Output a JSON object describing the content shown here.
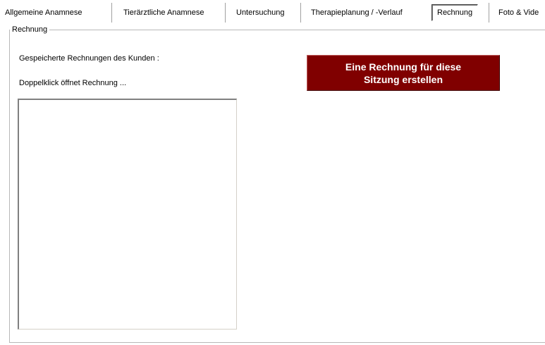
{
  "tabs": [
    {
      "label": "Allgemeine Anamnese",
      "active": false
    },
    {
      "label": "Tierärztliche Anamnese",
      "active": false
    },
    {
      "label": "Untersuchung",
      "active": false
    },
    {
      "label": "Therapieplanung / -Verlauf",
      "active": false
    },
    {
      "label": "Rechnung",
      "active": true
    },
    {
      "label": "Foto & Vide",
      "active": false
    }
  ],
  "groupbox": {
    "title": "Rechnung"
  },
  "invoices": {
    "saved_label": "Gespeicherte Rechnungen des Kunden :",
    "hint_label": "Doppelklick öffnet Rechnung ...",
    "items": []
  },
  "create_button": {
    "label": "Eine Rechnung für diese\nSitzung erstellen",
    "background": "#800000",
    "text_color": "#ffffff"
  }
}
